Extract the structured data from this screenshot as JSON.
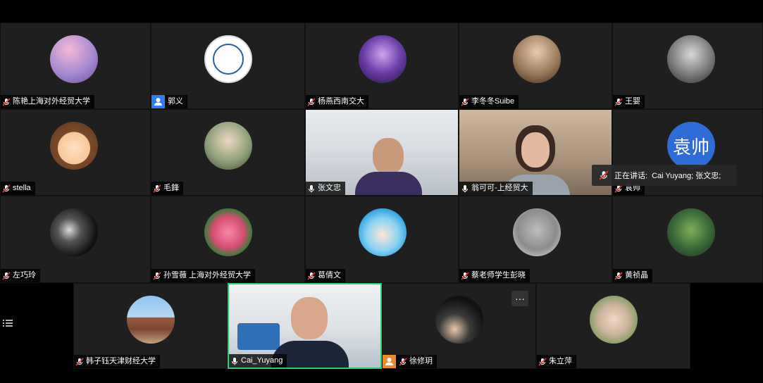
{
  "participants_grid": [
    {
      "name": "陈艳上海对外经贸大学"
    },
    {
      "name": "郭义"
    },
    {
      "name": "杨燕西南交大"
    },
    {
      "name": "李冬冬Suibe"
    },
    {
      "name": "王婴"
    },
    {
      "name": "stella"
    },
    {
      "name": "毛鋒"
    },
    {
      "name": "张文忠"
    },
    {
      "name": "翁可可-上经贸大"
    },
    {
      "name": "袁帅",
      "avatar_text": "袁帅"
    },
    {
      "name": "左巧玲"
    },
    {
      "name": "孙雪薇 上海对外经贸大学"
    },
    {
      "name": "葛倩文"
    },
    {
      "name": "蔡老师学生彭晓"
    },
    {
      "name": "黄祯晶"
    }
  ],
  "bottom_row": [
    {
      "name": "韩子钰天津财经大学"
    },
    {
      "name": "Cai_Yuyang"
    },
    {
      "name": "徐修玥"
    },
    {
      "name": "朱立萍"
    }
  ],
  "speaking": {
    "label": "正在讲话:",
    "names": "Cai Yuyang; 张文忠;"
  },
  "more_label": "···",
  "colors": {
    "active_border": "#2ecc71",
    "badge_blue": "#2d7cf6",
    "badge_orange": "#f08a24",
    "muted_red": "#e03b3b"
  }
}
